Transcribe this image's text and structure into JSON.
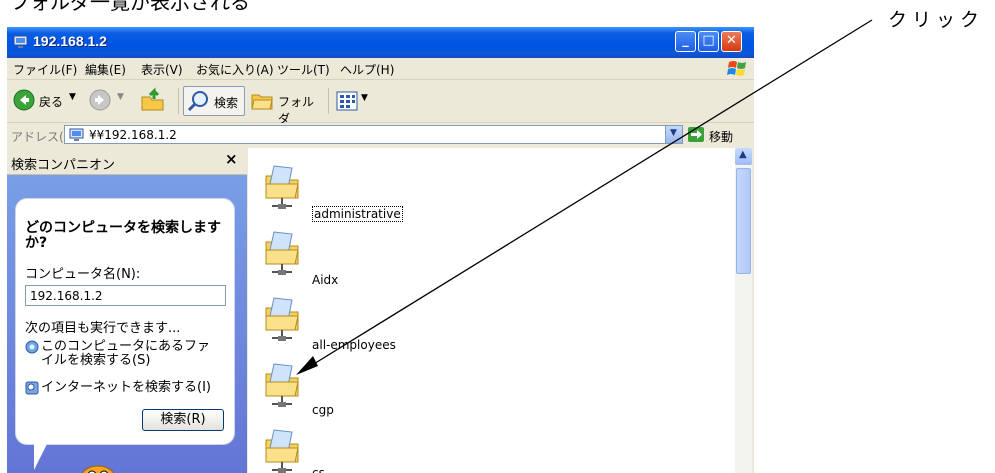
{
  "top_cut_text": "フォルダ一覧が表示される",
  "callout": "クリック",
  "window": {
    "title": "192.168.1.2",
    "buttons": {
      "minimize": "_",
      "maximize": "□",
      "close": "✕"
    }
  },
  "menu": [
    {
      "label": "ファイル(F)"
    },
    {
      "label": "編集(E)"
    },
    {
      "label": "表示(V)"
    },
    {
      "label": "お気に入り(A)"
    },
    {
      "label": "ツール(T)"
    },
    {
      "label": "ヘルプ(H)"
    }
  ],
  "toolbar": {
    "back_label": "戻る",
    "search_label": "検索",
    "folders_label": "フォルダ"
  },
  "address": {
    "label": "アドレス(D)",
    "value": "¥¥192.168.1.2",
    "go_label": "移動"
  },
  "sidepane": {
    "title": "検索コンパニオン",
    "close": "×",
    "question": "どのコンピュータを検索しますか?",
    "name_label": "コンピュータ名(N):",
    "name_value": "192.168.1.2",
    "other_label": "次の項目も実行できます...",
    "link1": "このコンピュータにあるファイルを検索する(S)",
    "link2": "インターネットを検索する(I)",
    "search_button": "検索(R)"
  },
  "folders": [
    {
      "name": "administrative",
      "selected": true
    },
    {
      "name": "Aidx",
      "selected": false
    },
    {
      "name": "all-employees",
      "selected": false
    },
    {
      "name": "cgp",
      "selected": false
    },
    {
      "name": "cs",
      "selected": false
    }
  ],
  "icons": [
    "computer-icon",
    "back-icon",
    "forward-icon",
    "up-folder-icon",
    "search-icon",
    "folders-icon",
    "views-icon",
    "go-icon",
    "search-file-icon",
    "internet-search-icon",
    "network-folder-icon",
    "dog-assistant-icon"
  ]
}
